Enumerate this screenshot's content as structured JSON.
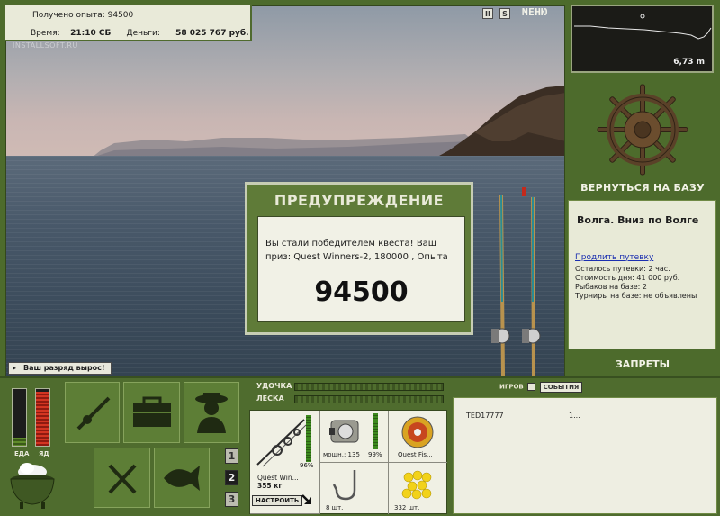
{
  "header": {
    "exp_label": "Получено опыта:",
    "exp_value": "94500",
    "time_label": "Время:",
    "time_value": "21:10 СБ",
    "money_label": "Деньги:",
    "money_value": "58 025 767 руб.",
    "watermark": "INSTALLSOFT.RU"
  },
  "top_controls": {
    "pause_glyph": "II",
    "sound_glyph": "S",
    "menu_label": "МЕНЮ"
  },
  "depth": {
    "value": "6,73 m"
  },
  "right_panel": {
    "back_to_base": "ВЕРНУТЬСЯ НА БАЗУ",
    "location_title": "Волга. Вниз по Волге",
    "extend_link": "Продлить путевку",
    "trip_left": "Осталось путевки: 2 час.",
    "day_cost": "Стоимость дня: 41 000 руб.",
    "anglers": "Рыбаков на базе: 2",
    "tournaments": "Турниры на базе: не объявлены",
    "bans": "ЗАПРЕТЫ"
  },
  "dialog": {
    "title": "ПРЕДУПРЕЖДЕНИЕ",
    "message": "Вы стали победителем квеста! Ваш приз: Quest Winners-2, 180000 , Опыта",
    "value": "94500"
  },
  "notice": {
    "rank_up": "Ваш разряд вырос!"
  },
  "gauges": {
    "food_label": "ЕДА",
    "poison_label": "ЯД",
    "food_level": 0.15,
    "poison_level": 0.95
  },
  "slots": {
    "page_buttons": [
      "1",
      "2",
      "3"
    ]
  },
  "tackle": {
    "rod_label": "УДОЧКА",
    "line_label": "ЛЕСКА",
    "rod_name": "Quest Win...",
    "rod_weight": "355 кг",
    "rod_percent": "96%",
    "setup_button": "НАСТРОИТЬ",
    "reel_label": "мощн.: 135",
    "reel_percent": "99%",
    "line_item": "Quest Fis...",
    "hooks_count": "8 шт.",
    "bait_count": "332 шт."
  },
  "chat": {
    "tab_players": "ИГРОВ",
    "tab_events": "СОБЫТИЯ",
    "row_name": "TED17777",
    "row_value": "1..."
  },
  "colors": {
    "panel_green": "#4f6c2e",
    "accent_red": "#c42a1c",
    "link_blue": "#1b2fb0"
  }
}
